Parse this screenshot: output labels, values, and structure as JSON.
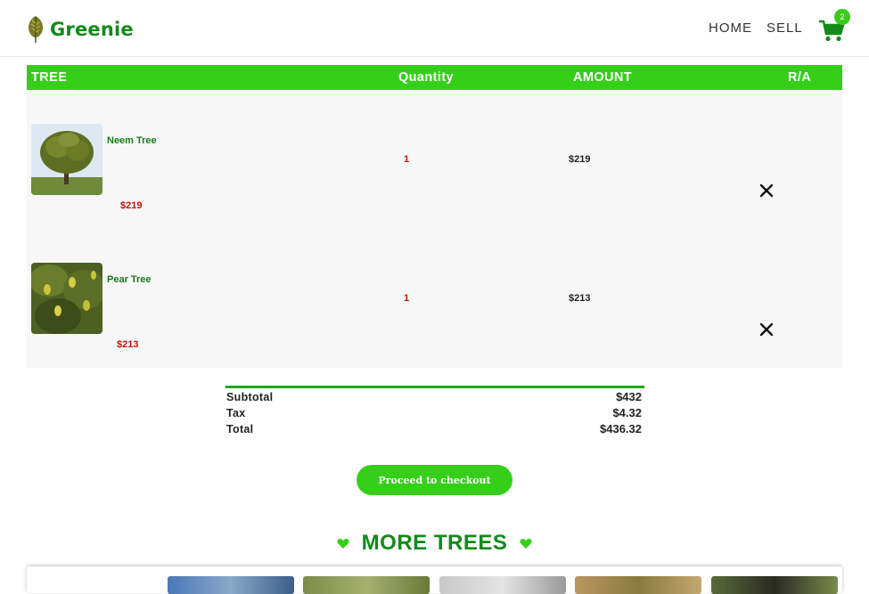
{
  "brand": {
    "name": "Greenie",
    "logo_icon": "leaf-icon"
  },
  "nav": {
    "home": "HOME",
    "sell": "SELL",
    "cart_count": "2",
    "cart_icon": "shopping-cart-icon"
  },
  "table": {
    "headers": {
      "tree": "TREE",
      "quantity": "Quantity",
      "amount": "AMOUNT",
      "ra": "R/A"
    },
    "items": [
      {
        "name": "Neem Tree",
        "price": "$219",
        "quantity": "1",
        "amount": "$219"
      },
      {
        "name": "Pear Tree",
        "price": "$213",
        "quantity": "1",
        "amount": "$213"
      }
    ]
  },
  "totals": {
    "subtotal_label": "Subtotal",
    "subtotal": "$432",
    "tax_label": "Tax",
    "tax": "$4.32",
    "total_label": "Total",
    "total": "$436.32"
  },
  "checkout_label": "Proceed to checkout",
  "more_trees": {
    "title": "MORE TREES",
    "icon": "heart-icon"
  },
  "colors": {
    "brand_green": "#138a1a",
    "accent_green": "#35cf1a",
    "price_red": "#d01010"
  }
}
